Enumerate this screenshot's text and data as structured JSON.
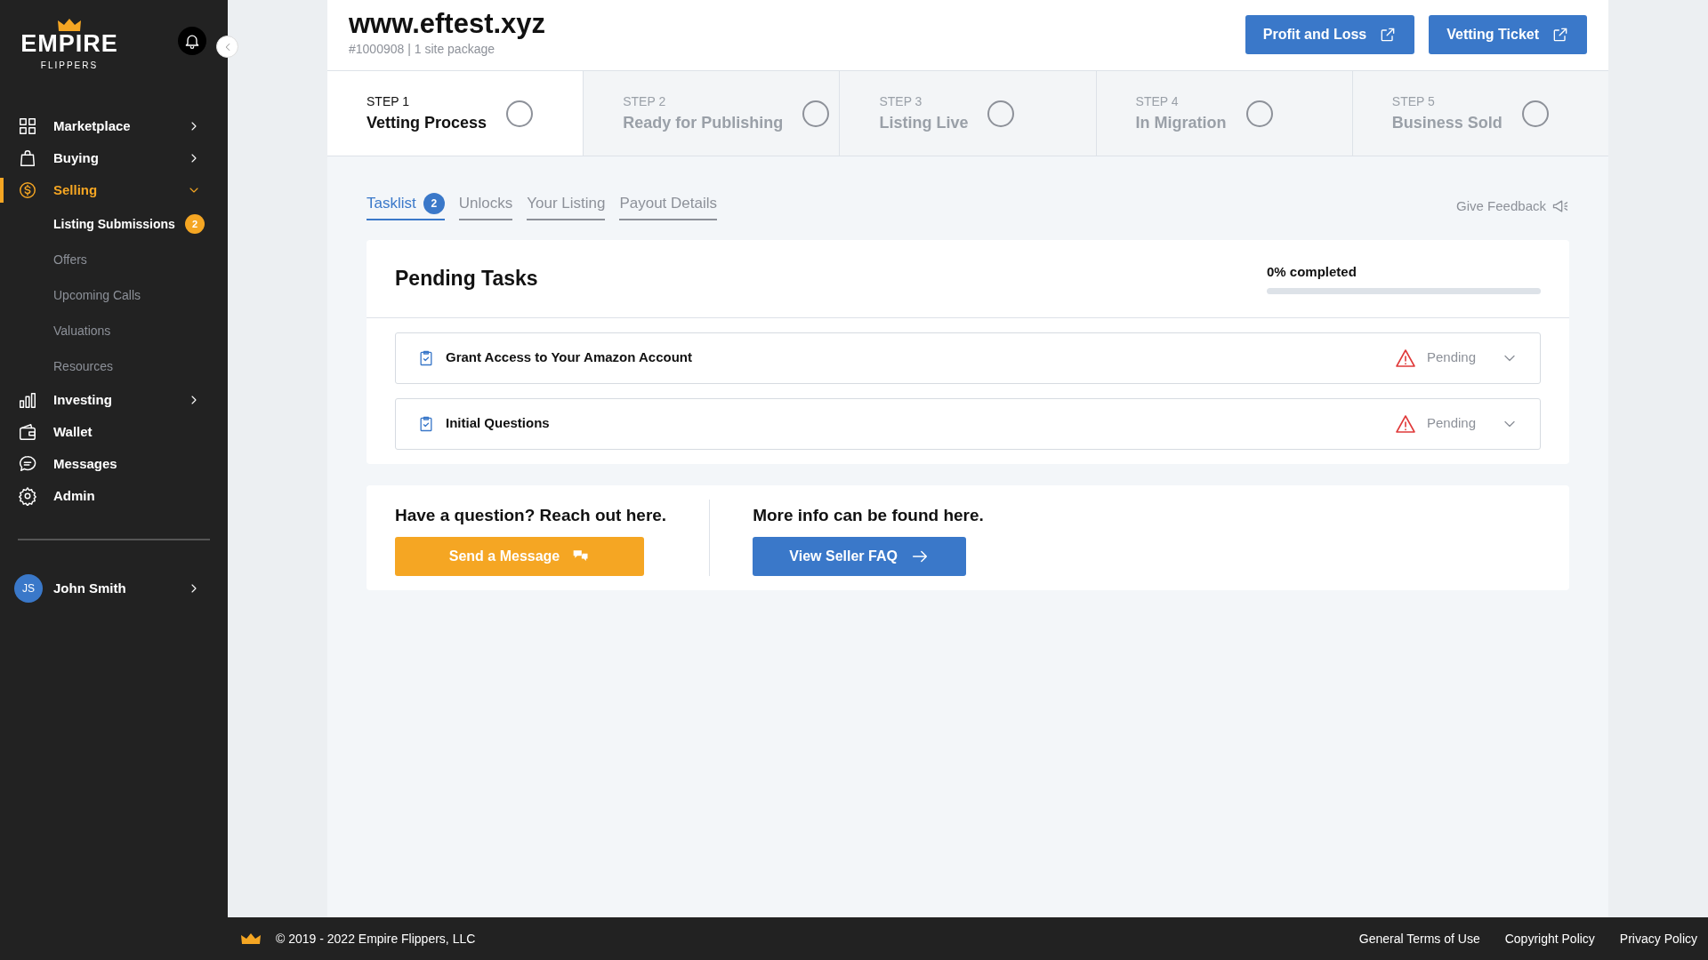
{
  "sidebar": {
    "logo": {
      "title": "EMPIRE",
      "subtitle": "FLIPPERS"
    },
    "items": [
      {
        "label": "Marketplace",
        "kind": "group",
        "expanded": false,
        "selected": false
      },
      {
        "label": "Buying",
        "kind": "group",
        "expanded": false,
        "selected": false
      },
      {
        "label": "Selling",
        "kind": "group",
        "expanded": true,
        "selected": true,
        "children": [
          {
            "label": "Listing Submissions",
            "selected": true,
            "badge": "2"
          },
          {
            "label": "Offers",
            "selected": false
          },
          {
            "label": "Upcoming Calls",
            "selected": false
          },
          {
            "label": "Valuations",
            "selected": false
          },
          {
            "label": "Resources",
            "selected": false
          }
        ]
      },
      {
        "label": "Investing",
        "kind": "group",
        "expanded": false,
        "selected": false
      },
      {
        "label": "Wallet",
        "kind": "link",
        "selected": false
      },
      {
        "label": "Messages",
        "kind": "link",
        "selected": false
      },
      {
        "label": "Admin",
        "kind": "link",
        "selected": false
      }
    ],
    "user": {
      "initials": "JS",
      "name": "John Smith"
    }
  },
  "header": {
    "title": "www.eftest.xyz",
    "subtitle": "#1000908 | 1 site package",
    "buttons": [
      "Profit and Loss",
      "Vetting Ticket"
    ]
  },
  "steps": [
    {
      "step": "STEP 1",
      "label": "Vetting Process",
      "selected": true
    },
    {
      "step": "STEP 2",
      "label": "Ready for Publishing",
      "selected": false
    },
    {
      "step": "STEP 3",
      "label": "Listing Live",
      "selected": false
    },
    {
      "step": "STEP 4",
      "label": "In Migration",
      "selected": false
    },
    {
      "step": "STEP 5",
      "label": "Business Sold",
      "selected": false
    }
  ],
  "tabs": [
    {
      "label": "Tasklist",
      "badge": "2",
      "selected": true
    },
    {
      "label": "Unlocks",
      "selected": false
    },
    {
      "label": "Your Listing",
      "selected": false
    },
    {
      "label": "Payout Details",
      "selected": false
    }
  ],
  "feedback": "Give Feedback",
  "tasks": {
    "title": "Pending Tasks",
    "progress_label": "0% completed",
    "level": 0,
    "items": [
      {
        "label": "Grant Access to Your Amazon Account",
        "status": "Pending"
      },
      {
        "label": "Initial Questions",
        "status": "Pending"
      }
    ]
  },
  "help": [
    {
      "kind": "message",
      "text": "Have a question? Reach out here.",
      "button": "Send a Message"
    },
    {
      "kind": "faq",
      "text": "More info can be found here.",
      "button": "View Seller FAQ"
    }
  ],
  "footer": {
    "copyright": "© 2019 - 2022 Empire Flippers, LLC",
    "links": [
      "General Terms of Use",
      "Copyright Policy",
      "Privacy Policy"
    ]
  }
}
